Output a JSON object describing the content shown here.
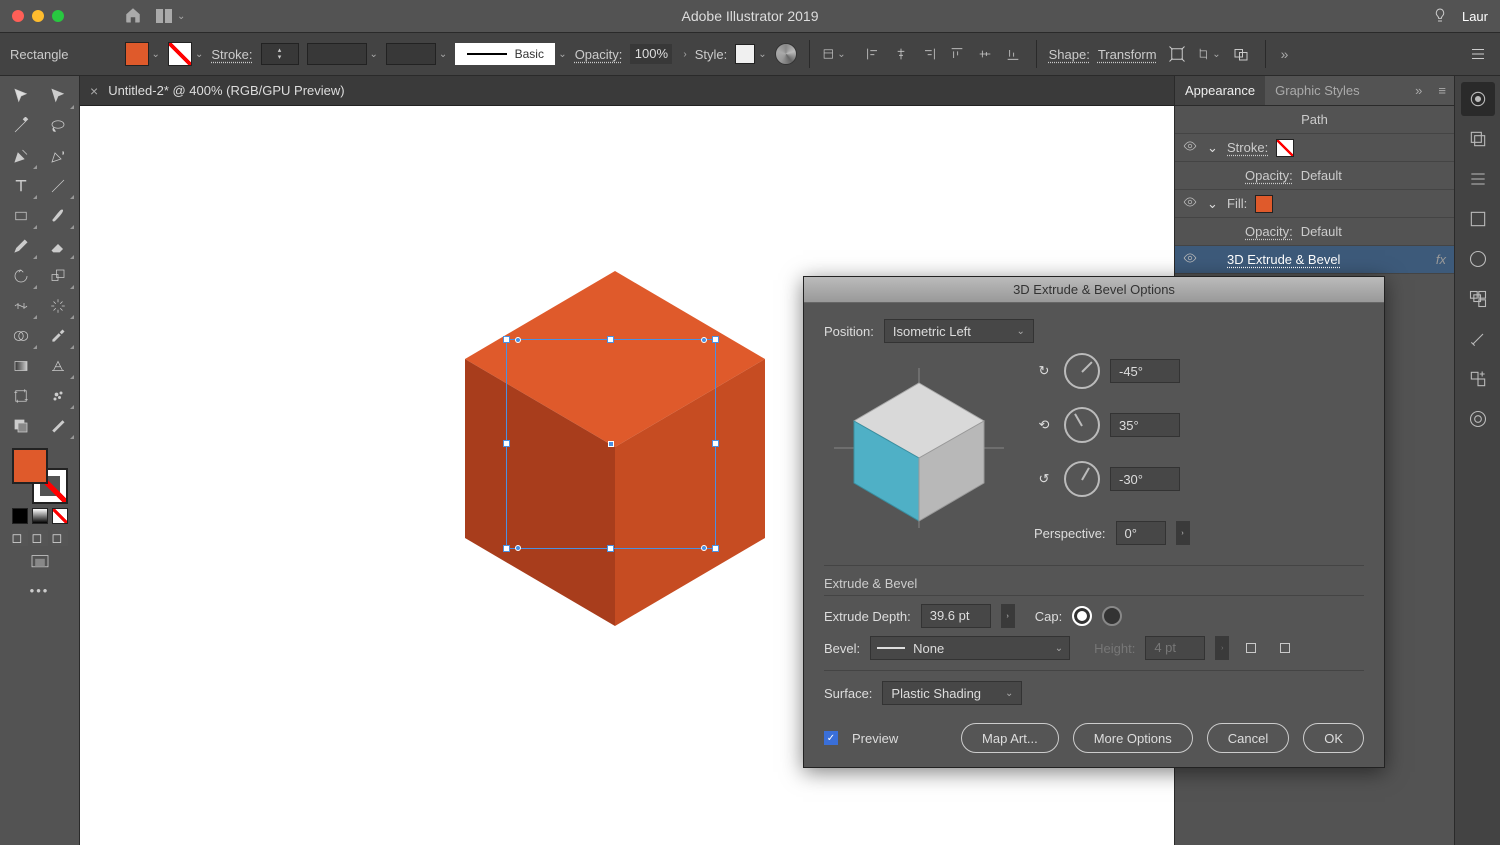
{
  "app": {
    "title": "Adobe Illustrator 2019",
    "user": "Laur"
  },
  "options": {
    "shape": "Rectangle",
    "fill_color": "#df5a2b",
    "stroke_label": "Stroke:",
    "brush_def": "Basic",
    "opacity_label": "Opacity:",
    "opacity_value": "100%",
    "style_label": "Style:",
    "shape_btn": "Shape:",
    "transform_btn": "Transform"
  },
  "document": {
    "tab": "Untitled-2* @ 400% (RGB/GPU Preview)"
  },
  "panels": {
    "tabs": [
      "Appearance",
      "Graphic Styles"
    ],
    "head": "Path",
    "rows": [
      {
        "label": "Stroke:",
        "swatch": "nostroke"
      },
      {
        "label": "Opacity:",
        "value": "Default"
      },
      {
        "label": "Fill:",
        "swatch": "fill"
      },
      {
        "label": "Opacity:",
        "value": "Default"
      },
      {
        "label": "3D Extrude & Bevel",
        "fx": true
      }
    ]
  },
  "dialog": {
    "title": "3D Extrude & Bevel Options",
    "position_label": "Position:",
    "position_value": "Isometric Left",
    "axes": [
      {
        "value": "-45°"
      },
      {
        "value": "35°"
      },
      {
        "value": "-30°"
      }
    ],
    "perspective_label": "Perspective:",
    "perspective_value": "0°",
    "section1_head": "Extrude & Bevel",
    "extrude_depth_label": "Extrude Depth:",
    "extrude_depth_value": "39.6 pt",
    "cap_label": "Cap:",
    "bevel_label": "Bevel:",
    "bevel_value": "None",
    "height_label": "Height:",
    "height_value": "4 pt",
    "surface_label": "Surface:",
    "surface_value": "Plastic Shading",
    "preview_label": "Preview",
    "buttons": {
      "map": "Map Art...",
      "more": "More Options",
      "cancel": "Cancel",
      "ok": "OK"
    }
  }
}
